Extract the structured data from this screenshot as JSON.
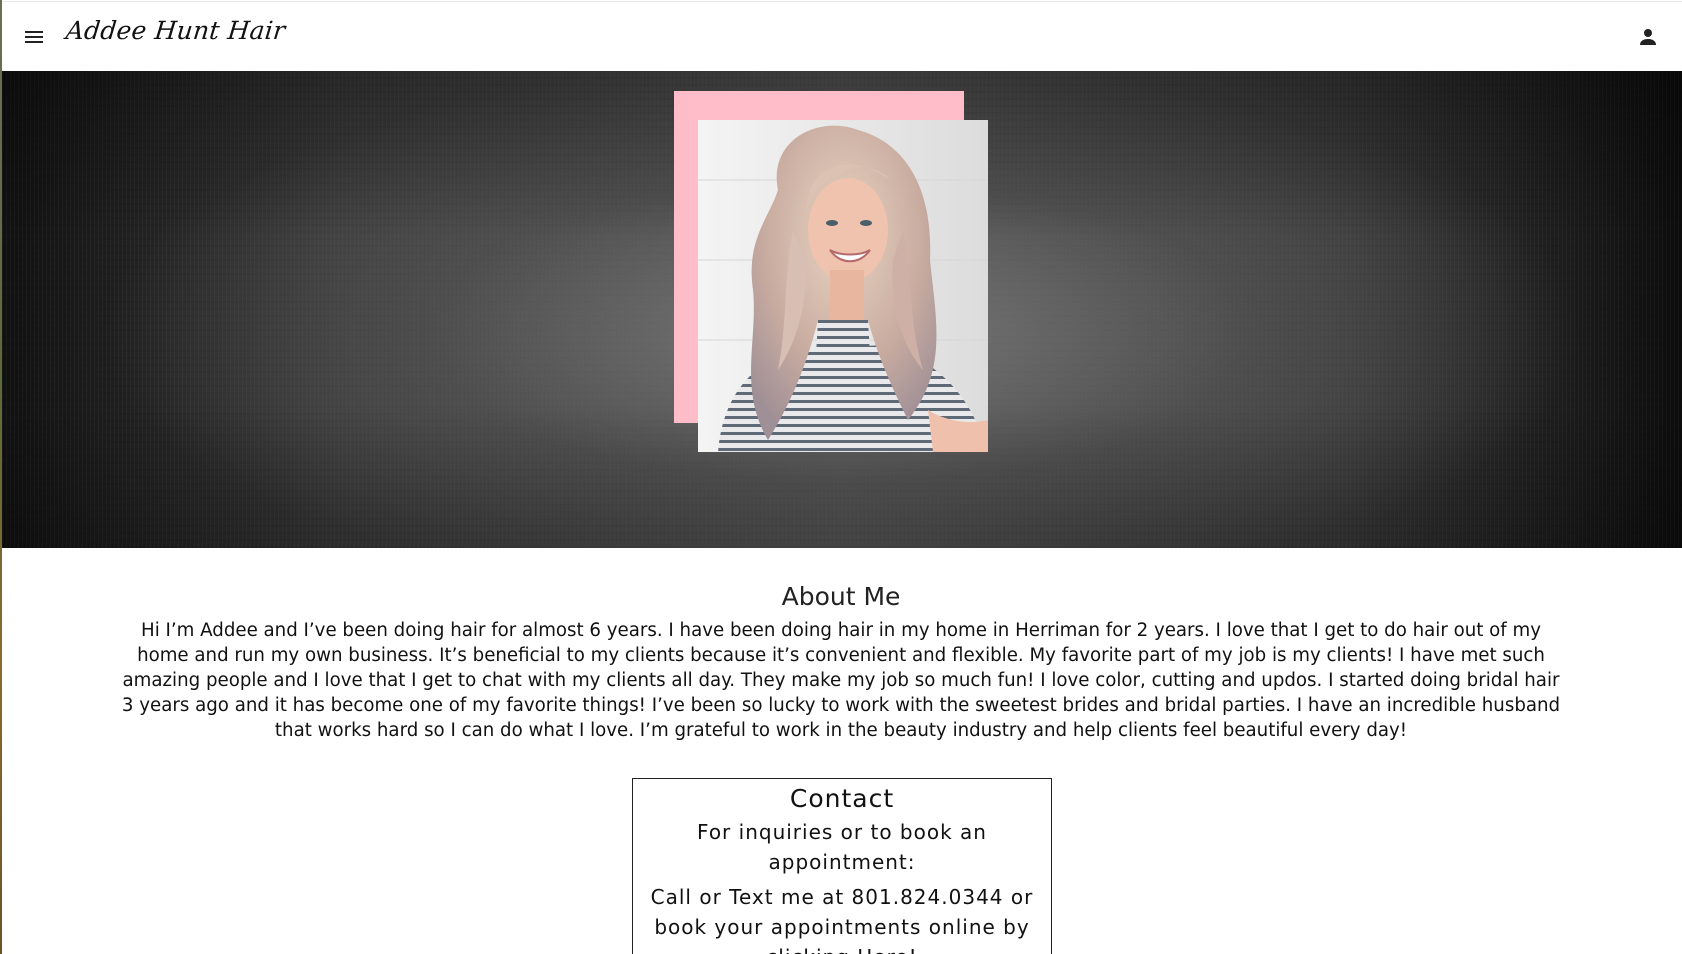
{
  "header": {
    "brand": "Addee Hunt Hair",
    "menu_icon": "menu-icon",
    "account_icon": "account-icon"
  },
  "hero": {
    "accent_color": "#ffbdc9",
    "photo_alt": "Addee Hunt portrait"
  },
  "about": {
    "title": "About Me",
    "body": "Hi I’m Addee and I’ve been doing hair for almost 6 years. I have been doing hair in my home in Herriman for 2 years. I love that I get to do hair out of my home and run my own business. It’s beneficial to my clients because it’s convenient and flexible. My favorite part of my job is my clients! I have met such amazing people and I love that I get to chat with my clients all day. They make my job so much fun! I love color, cutting and updos. I started doing bridal hair 3 years ago and it has become one of my favorite things! I’ve been so lucky to work with the sweetest brides and bridal parties. I have an incredible husband that works hard so I can do what I love. I’m grateful to work in the beauty industry and help clients feel beautiful every day!"
  },
  "contact": {
    "title": "Contact",
    "inquiries": "For inquiries or to book an appointment:",
    "call_text": "Call or Text me at 801.824.0344 or book your appointments online by clicking Here!"
  }
}
